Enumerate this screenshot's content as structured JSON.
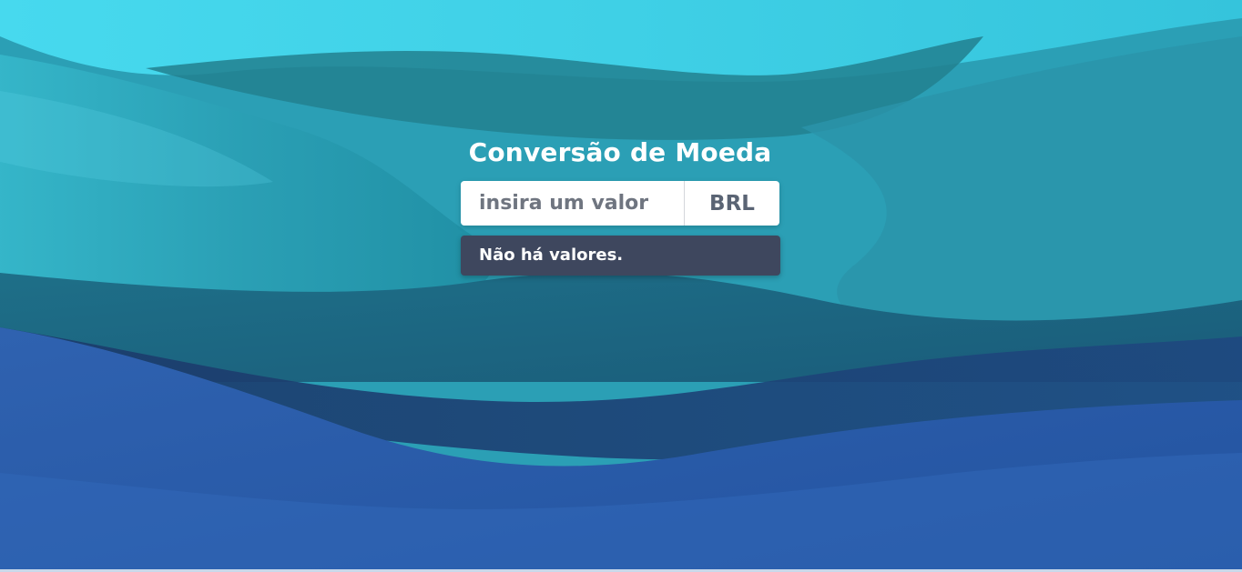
{
  "page": {
    "title": "Conversão de Moeda"
  },
  "converter": {
    "input_placeholder": "insira um valor",
    "currency_label": "BRL",
    "result_text": "Não há valores."
  },
  "colors": {
    "bg_top": "#3fd7ec",
    "bg_mid": "#2aa9bd",
    "bg_bottom": "#2a5ea8",
    "result_bg": "#3e475e",
    "title_text": "#ffffff"
  }
}
